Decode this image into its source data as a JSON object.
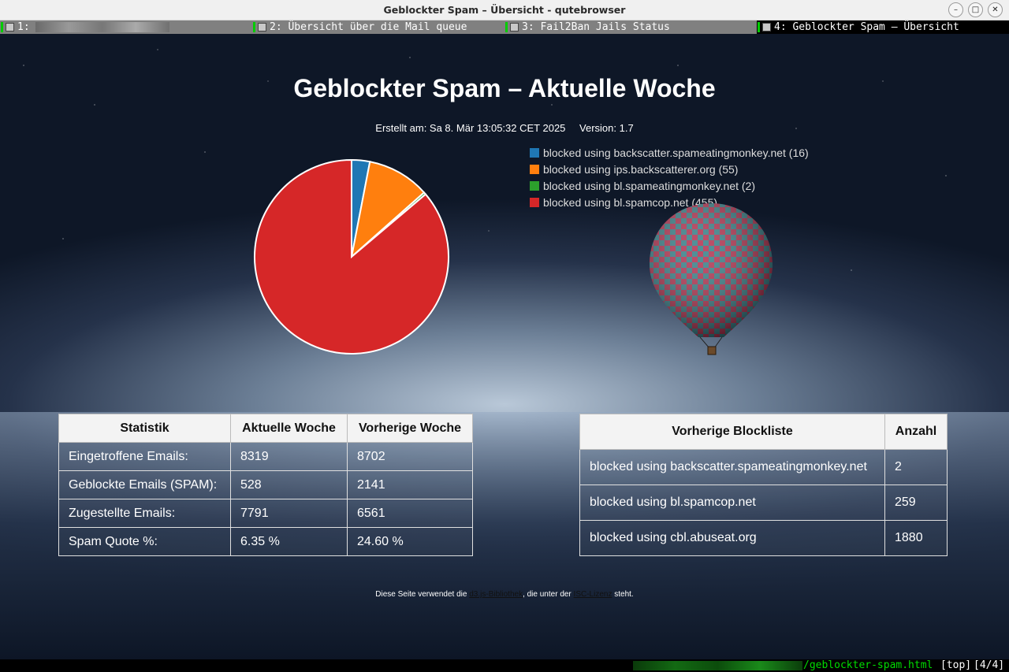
{
  "window": {
    "title": "Geblockter Spam – Übersicht - qutebrowser",
    "minimize_glyph": "–",
    "maximize_glyph": "□",
    "close_glyph": "✕"
  },
  "tabs": [
    {
      "label": "1:",
      "selected": false
    },
    {
      "label": "2: Übersicht über die Mail queue",
      "selected": false
    },
    {
      "label": "3: Fail2Ban Jails Status",
      "selected": false
    },
    {
      "label": "4: Geblockter Spam – Übersicht",
      "selected": true
    }
  ],
  "page": {
    "title": "Geblockter Spam – Aktuelle Woche",
    "created": "Erstellt am: Sa 8. Mär 13:05:32 CET 2025",
    "version": "Version: 1.7"
  },
  "chart_data": {
    "type": "pie",
    "slices": [
      {
        "label": "blocked using backscatter.spameatingmonkey.net",
        "value": 16,
        "color": "#1f77b4"
      },
      {
        "label": "blocked using ips.backscatterer.org",
        "value": 55,
        "color": "#ff7f0e"
      },
      {
        "label": "blocked using bl.spameatingmonkey.net",
        "value": 2,
        "color": "#2ca02c"
      },
      {
        "label": "blocked using bl.spamcop.net",
        "value": 455,
        "color": "#d62728"
      }
    ],
    "legend": [
      "blocked using backscatter.spameatingmonkey.net (16)",
      "blocked using ips.backscatterer.org (55)",
      "blocked using bl.spameatingmonkey.net (2)",
      "blocked using bl.spamcop.net (455)"
    ],
    "legend_position": "right"
  },
  "stats_table": {
    "headers": [
      "Statistik",
      "Aktuelle Woche",
      "Vorherige Woche"
    ],
    "rows": [
      [
        "Eingetroffene Emails:",
        "8319",
        "8702"
      ],
      [
        "Geblockte Emails (SPAM):",
        "528",
        "2141"
      ],
      [
        "Zugestellte Emails:",
        "7791",
        "6561"
      ],
      [
        "Spam Quote %:",
        "6.35 %",
        "24.60 %"
      ]
    ]
  },
  "blocklist_table": {
    "headers": [
      "Vorherige Blockliste",
      "Anzahl"
    ],
    "rows": [
      [
        "blocked using backscatter.spameatingmonkey.net",
        "2"
      ],
      [
        "blocked using bl.spamcop.net",
        "259"
      ],
      [
        "blocked using cbl.abuseat.org",
        "1880"
      ]
    ]
  },
  "footer": {
    "pre": "Diese Seite verwendet die ",
    "link1": "d3.js-Bibliothek",
    "mid": ", die unter der ",
    "link2": "ISC-Lizenz",
    "post": " steht."
  },
  "statusbar": {
    "url": "/geblockter-spam.html",
    "position": "[top]",
    "tab_count": "[4/4]"
  }
}
